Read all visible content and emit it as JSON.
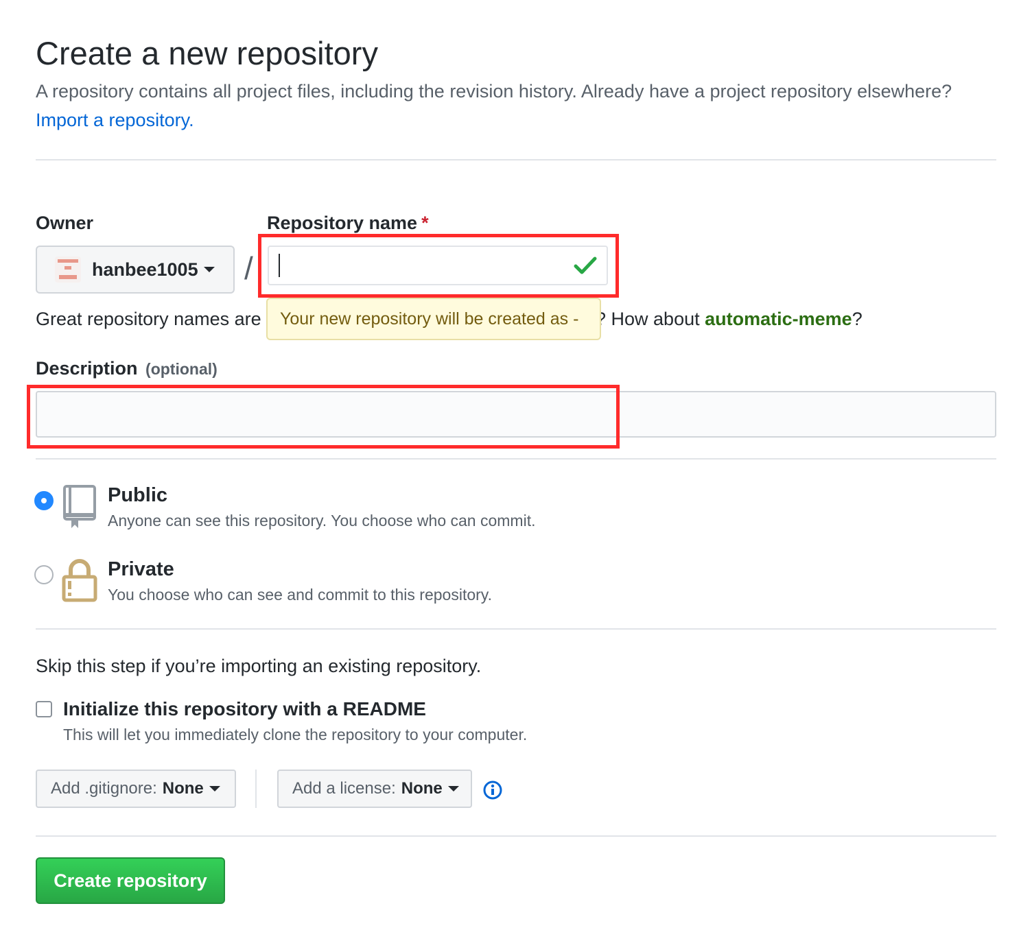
{
  "page": {
    "title": "Create a new repository",
    "subtitle": "A repository contains all project files, including the revision history. Already have a project repository elsewhere?",
    "import_link": "Import a repository."
  },
  "form": {
    "owner_label": "Owner",
    "owner_name": "hanbee1005",
    "slash": "/",
    "repo_name_label": "Repository name",
    "required_mark": "*",
    "repo_name_value": "",
    "tooltip": "Your new repository will be created as -",
    "hint_prefix": "Great repository names are",
    "hint_mid": "? How about",
    "hint_suggestion": "automatic-meme",
    "hint_suffix": "?",
    "description_label": "Description",
    "description_optional": "(optional)",
    "description_value": ""
  },
  "visibility": {
    "public_title": "Public",
    "public_desc": "Anyone can see this repository. You choose who can commit.",
    "private_title": "Private",
    "private_desc": "You choose who can see and commit to this repository.",
    "selected": "public"
  },
  "init": {
    "skip_text": "Skip this step if you’re importing an existing repository.",
    "readme_title": "Initialize this repository with a README",
    "readme_desc": "This will let you immediately clone the repository to your computer.",
    "readme_checked": false,
    "gitignore_label": "Add .gitignore:",
    "gitignore_value": "None",
    "license_label": "Add a license:",
    "license_value": "None"
  },
  "actions": {
    "create_label": "Create repository"
  },
  "colors": {
    "link": "#0366d6",
    "primary_button": "#2ea44f",
    "highlight_box": "#ff2b2b",
    "tooltip_bg": "#fffbdd",
    "radio_checked": "#2188ff"
  },
  "icons": {
    "repo": "repo-icon",
    "lock": "lock-icon",
    "check": "check-icon",
    "info": "info-icon",
    "caret": "caret-down-icon"
  }
}
